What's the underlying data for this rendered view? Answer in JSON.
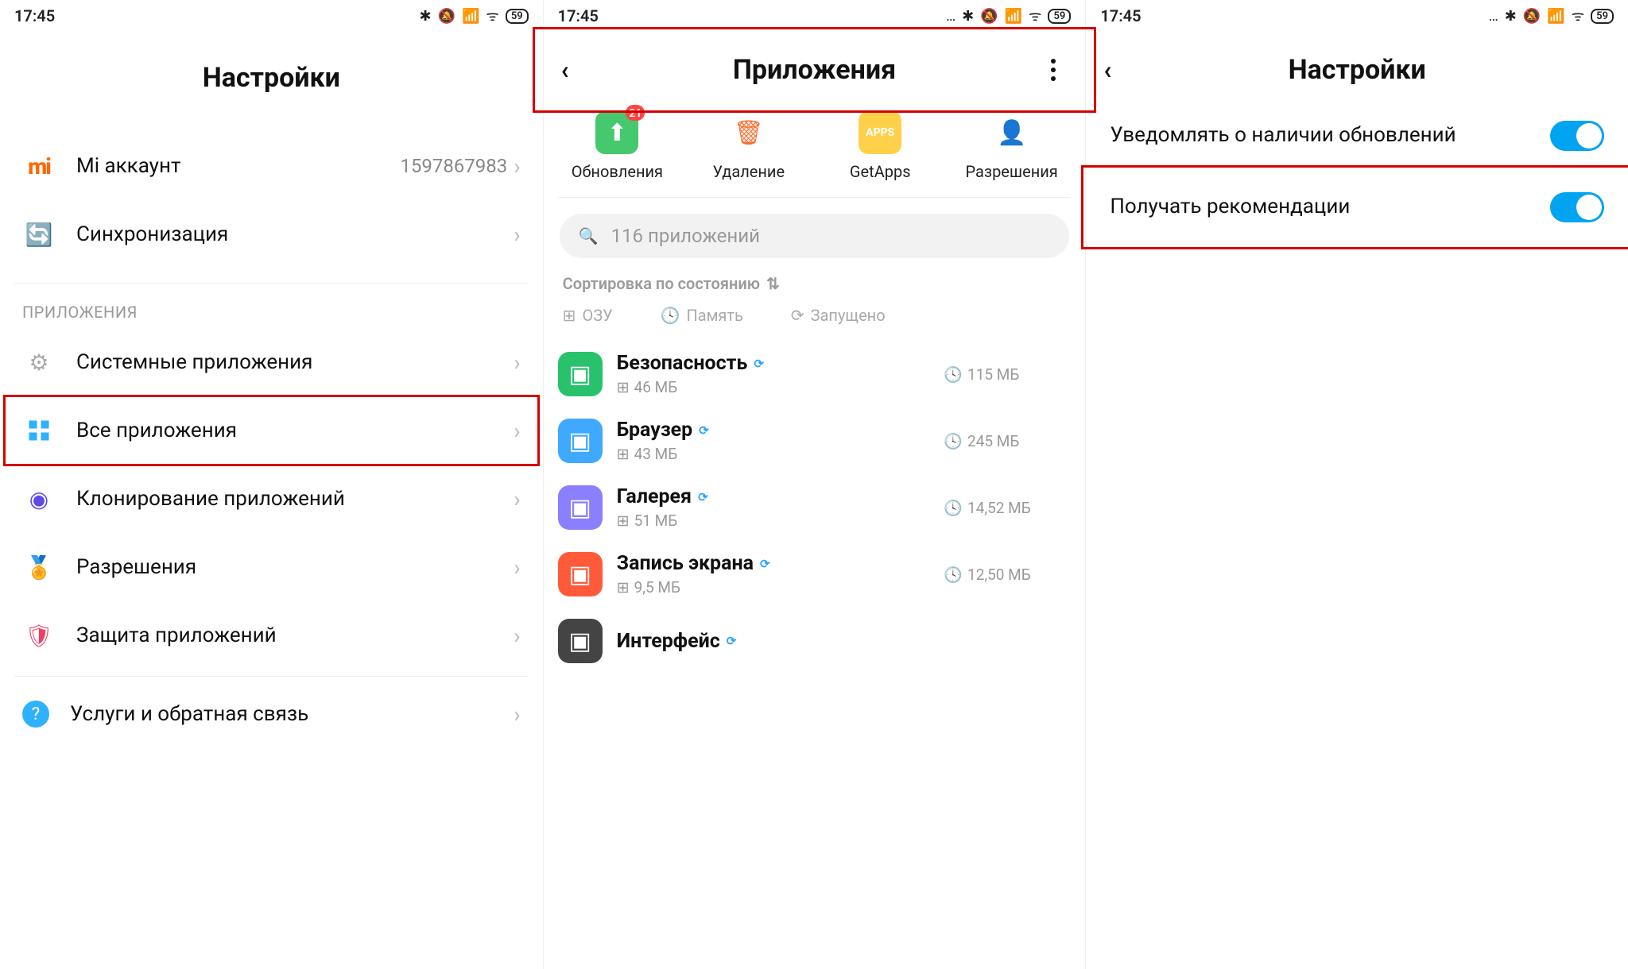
{
  "panel1": {
    "status": {
      "time": "17:45",
      "battery": "59"
    },
    "title": "Настройки",
    "account": {
      "label": "Mi аккаунт",
      "value": "1597867983"
    },
    "sync": {
      "label": "Синхронизация"
    },
    "section_apps_title": "ПРИЛОЖЕНИЯ",
    "items": {
      "system_apps": "Системные приложения",
      "all_apps": "Все приложения",
      "cloning": "Клонирование приложений",
      "permissions": "Разрешения",
      "app_protection": "Защита приложений",
      "feedback": "Услуги и обратная связь"
    }
  },
  "panel2": {
    "status": {
      "time": "17:45",
      "battery": "59"
    },
    "title": "Приложения",
    "actions": {
      "updates": {
        "label": "Обновления",
        "badge": "21"
      },
      "uninstall": {
        "label": "Удаление"
      },
      "getapps": {
        "label": "GetApps"
      },
      "permissions": {
        "label": "Разрешения"
      }
    },
    "search_placeholder": "116 приложений",
    "sort_label": "Сортировка по состоянию",
    "chips": {
      "ram": "ОЗУ",
      "storage": "Память",
      "running": "Запущено"
    },
    "apps": [
      {
        "name": "Безопасность",
        "ram": "46 МБ",
        "storage": "115 МБ",
        "color": "#28c26d"
      },
      {
        "name": "Браузер",
        "ram": "43 МБ",
        "storage": "245 МБ",
        "color": "#3fa9ff"
      },
      {
        "name": "Галерея",
        "ram": "51 МБ",
        "storage": "14,52 МБ",
        "color": "#8a80ff"
      },
      {
        "name": "Запись экрана",
        "ram": "9,5 МБ",
        "storage": "12,50 МБ",
        "color": "#ff5b3b"
      },
      {
        "name": "Интерфейс",
        "ram": "",
        "storage": "",
        "color": "#444"
      }
    ]
  },
  "panel3": {
    "status": {
      "time": "17:45",
      "battery": "59"
    },
    "title": "Настройки",
    "toggles": {
      "updates_notify": "Уведомлять о наличии обновлений",
      "recommendations": "Получать рекомендации"
    }
  }
}
